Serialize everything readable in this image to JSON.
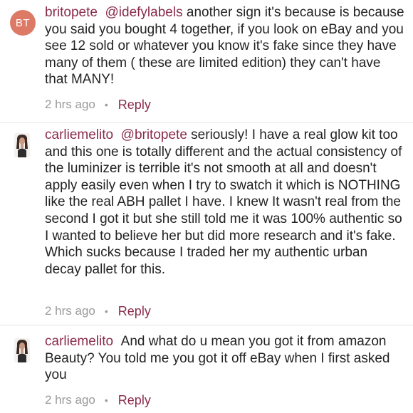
{
  "comments": [
    {
      "avatar_initials": "BT",
      "username": "britopete",
      "mention": "@idefylabels",
      "text": "another sign it's because is because you said you bought 4 together, if you look on eBay and you see 12 sold or whatever you know it's fake since they have many of them ( these are limited edition) they can't have that MANY!",
      "time": "2 hrs ago",
      "separator": "•",
      "reply_label": "Reply"
    },
    {
      "avatar_icon": "user-photo-avatar",
      "username": "carliemelito",
      "mention": "@britopete",
      "text": "seriously! I have a real glow kit too and this one is totally different and the actual consistency of the luminizer is terrible it's not smooth at all and doesn't apply easily even when I try to swatch it which is NOTHING like the real ABH pallet I have. I knew It wasn't real from the second I got it but she still told me it was 100% authentic so I wanted to believe her but did more research and it's fake. Which sucks because I traded her my authentic urban decay pallet for this.",
      "time": "2 hrs ago",
      "separator": "•",
      "reply_label": "Reply"
    },
    {
      "avatar_icon": "user-photo-avatar",
      "username": "carliemelito",
      "text": "And what do u mean you got it from amazon Beauty? You told me you got it off eBay when I first asked you",
      "time": "2 hrs ago",
      "separator": "•",
      "reply_label": "Reply"
    }
  ],
  "colors": {
    "username": "#8a2b4b",
    "body_text": "#222222",
    "timestamp": "#9a9a9a",
    "avatar_bg": "#dc7a66",
    "divider": "#e3e3e3"
  }
}
